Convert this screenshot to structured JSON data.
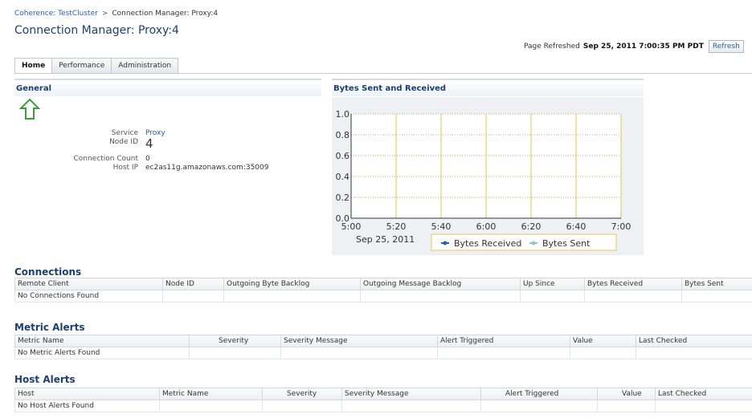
{
  "breadcrumb": {
    "parent": "Coherence: TestCluster",
    "separator": ">",
    "current": "Connection Manager: Proxy:4"
  },
  "page_title": "Connection Manager: Proxy:4",
  "refresh": {
    "label": "Page Refreshed",
    "timestamp": "Sep 25, 2011 7:00:35 PM PDT",
    "button": "Refresh"
  },
  "tabs": [
    {
      "label": "Home",
      "active": true
    },
    {
      "label": "Performance",
      "active": false
    },
    {
      "label": "Administration",
      "active": false
    }
  ],
  "general": {
    "title": "General",
    "status_icon": "up-arrow-icon",
    "status_color": "#3aa035",
    "properties": [
      {
        "label": "Service",
        "value": "Proxy"
      },
      {
        "label": "Node ID",
        "value": "4"
      },
      {
        "label": "Connection Count",
        "value": "0"
      },
      {
        "label": "Host IP",
        "value": "ec2as11g.amazonaws.com:35009"
      }
    ]
  },
  "chart_panel": {
    "title": "Bytes Sent and Received"
  },
  "chart_data": {
    "type": "line",
    "x": [
      "5:00",
      "5:20",
      "5:40",
      "6:00",
      "6:20",
      "6:40",
      "7:00"
    ],
    "x_date_label": "Sep 25, 2011",
    "ylim": [
      0,
      1.0
    ],
    "y_ticks": [
      "0.0",
      "0.2",
      "0.4",
      "0.6",
      "0.8",
      "1.0"
    ],
    "grid": true,
    "legend_position": "bottom",
    "series": [
      {
        "name": "Bytes Received",
        "color": "#2e5fb0",
        "values": []
      },
      {
        "name": "Bytes Sent",
        "color": "#8fc6c8",
        "values": []
      }
    ]
  },
  "connections": {
    "title": "Connections",
    "columns": [
      "Remote Client",
      "Node ID",
      "Outgoing Byte Backlog",
      "Outgoing Message Backlog",
      "Up Since",
      "Bytes Received",
      "Bytes Sent"
    ],
    "empty": "No Connections Found"
  },
  "metric_alerts": {
    "title": "Metric Alerts",
    "columns": [
      "Metric Name",
      "Severity",
      "Severity Message",
      "Alert Triggered",
      "Value",
      "Last Checked"
    ],
    "empty": "No Metric Alerts Found"
  },
  "host_alerts": {
    "title": "Host Alerts",
    "columns": [
      "Host",
      "Metric Name",
      "Severity",
      "Severity Message",
      "Alert Triggered",
      "Value",
      "Last Checked"
    ],
    "empty": "No Host Alerts Found"
  }
}
